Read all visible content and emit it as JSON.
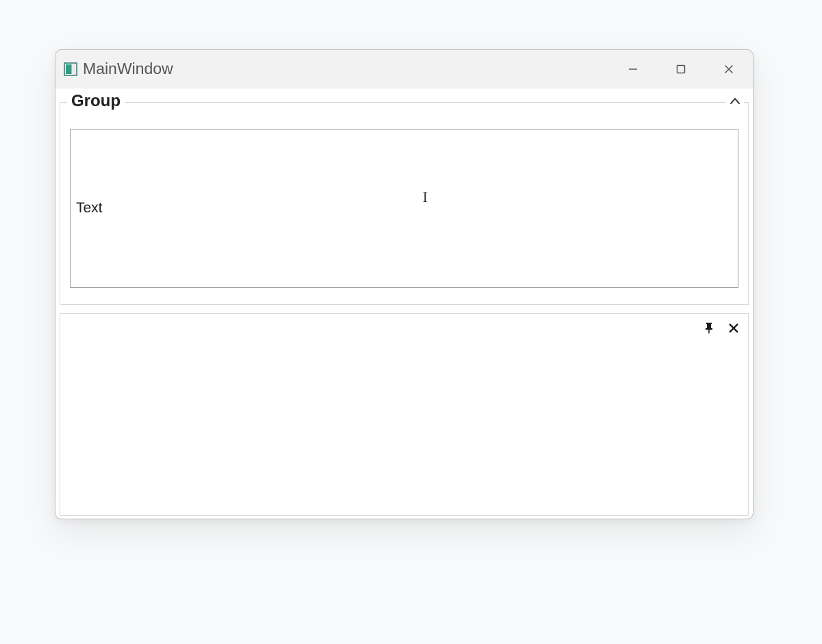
{
  "window": {
    "title": "MainWindow"
  },
  "group": {
    "label": "Group",
    "text_value": "Text"
  }
}
